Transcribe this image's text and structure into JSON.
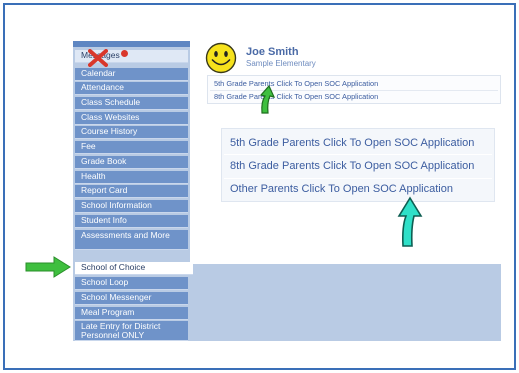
{
  "sidebar": {
    "items": [
      {
        "label": "Messages",
        "style": "messages"
      },
      {
        "label": "Calendar",
        "style": "normal"
      },
      {
        "label": "Attendance",
        "style": "normal"
      },
      {
        "label": "Class Schedule",
        "style": "normal"
      },
      {
        "label": "Class Websites",
        "style": "normal"
      },
      {
        "label": "Course History",
        "style": "normal"
      },
      {
        "label": "Fee",
        "style": "normal"
      },
      {
        "label": "Grade Book",
        "style": "normal"
      },
      {
        "label": "Health",
        "style": "normal"
      },
      {
        "label": "Report Card",
        "style": "normal"
      },
      {
        "label": "School Information",
        "style": "normal"
      },
      {
        "label": "Student Info",
        "style": "normal"
      },
      {
        "label": "Assessments and More",
        "style": "tall"
      },
      {
        "label": "School of Choice",
        "style": "active"
      },
      {
        "label": "School Loop",
        "style": "normal"
      },
      {
        "label": "School Messenger",
        "style": "normal"
      },
      {
        "label": "Meal Program",
        "style": "normal"
      },
      {
        "label": "Late Entry for District Personnel ONLY",
        "style": "tall"
      }
    ]
  },
  "header": {
    "user_name": "Joe Smith",
    "school_name": "Sample Elementary"
  },
  "small_links": [
    "5th Grade Parents Click To Open SOC Application",
    "8th Grade Parents Click To Open SOC Application"
  ],
  "options": [
    "5th Grade Parents Click To Open SOC Application",
    "8th Grade Parents Click To Open SOC Application",
    "Other Parents Click To Open SOC Application"
  ],
  "colors": {
    "frame_border": "#3a6fb8",
    "nav_bg": "#6f93c9",
    "sidebar_bg": "#b9cbe4",
    "link_color": "#3c5da0",
    "arrow_green": "#3fbf3f",
    "arrow_cyan": "#2fe0c8",
    "x_mark": "#d9372b",
    "smiley": "#f6e21c"
  },
  "icons": [
    "smiley-face-icon",
    "red-x-mark-icon",
    "green-arrow-icon",
    "up-arrow-icon"
  ]
}
